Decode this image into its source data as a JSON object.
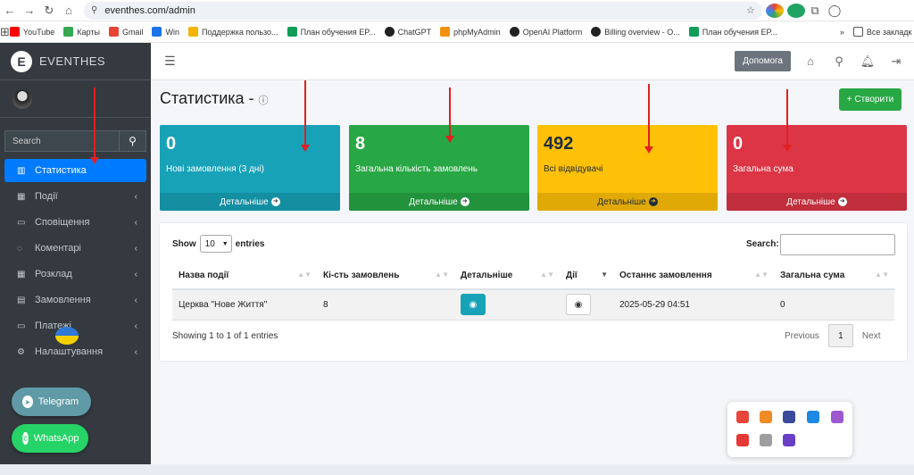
{
  "browser": {
    "url": "eventhes.com/admin",
    "bookmarks": [
      {
        "label": "YouTube",
        "color": "#ff0000"
      },
      {
        "label": "Карты",
        "color": "#34a853"
      },
      {
        "label": "Gmail",
        "color": "#ea4335"
      },
      {
        "label": "Win",
        "color": "#1a73e8"
      },
      {
        "label": "Поддержка пользо...",
        "color": "#f4b400"
      },
      {
        "label": "План обучения EP...",
        "color": "#0f9d58"
      },
      {
        "label": "ChatGPT",
        "color": "#222222"
      },
      {
        "label": "phpMyAdmin",
        "color": "#f29111"
      },
      {
        "label": "OpenAI Platform",
        "color": "#222222"
      },
      {
        "label": "Billing overview - O...",
        "color": "#222222"
      },
      {
        "label": "План обучения EP...",
        "color": "#0f9d58"
      }
    ],
    "bookmarks_more": "»",
    "all_bookmarks": "Все закладк"
  },
  "sidebar": {
    "brand_letter": "E",
    "brand_name": "EVENTHES",
    "search_placeholder": "Search",
    "menu": [
      {
        "label": "Статистика",
        "icon": "chart-icon",
        "glyph": "▥",
        "active": true
      },
      {
        "label": "Події",
        "icon": "calendar-icon",
        "glyph": "▦",
        "active": false
      },
      {
        "label": "Сповіщення",
        "icon": "message-icon",
        "glyph": "▭",
        "active": false
      },
      {
        "label": "Коментарі",
        "icon": "comment-icon",
        "glyph": "◌",
        "active": false
      },
      {
        "label": "Розклад",
        "icon": "schedule-icon",
        "glyph": "▦",
        "active": false
      },
      {
        "label": "Замовлення",
        "icon": "orders-icon",
        "glyph": "▤",
        "active": false
      },
      {
        "label": "Платежі",
        "icon": "payments-icon",
        "glyph": "▭",
        "active": false
      },
      {
        "label": "Налаштування",
        "icon": "settings-icon",
        "glyph": "⚙",
        "active": false
      }
    ],
    "telegram_label": "Telegram",
    "whatsapp_label": "WhatsApp"
  },
  "topbar": {
    "help_label": "Допомога"
  },
  "page": {
    "title": "Статистика -",
    "create_label": "+ Створити"
  },
  "cards": [
    {
      "value": "0",
      "label": "Нові замовлення (3 дні)",
      "more": "Детальніше",
      "color": "#17a2b8"
    },
    {
      "value": "8",
      "label": "Загальна кількість замовлень",
      "more": "Детальніше",
      "color": "#28a745"
    },
    {
      "value": "492",
      "label": "Всі відвідувачі",
      "more": "Детальніше",
      "color": "#ffc107"
    },
    {
      "value": "0",
      "label": "Загальна сума",
      "more": "Детальніше",
      "color": "#dc3545"
    }
  ],
  "table": {
    "show_label": "Show",
    "entries_value": "10",
    "entries_label": "entries",
    "search_label": "Search:",
    "columns": [
      "Назва події",
      "Кі-сть замовлень",
      "Детальніше",
      "Дії",
      "Останнє замовлення",
      "Загальна сума"
    ],
    "rows": [
      {
        "name": "Церква \"Нове Життя\"",
        "count": "8",
        "last_order": "2025-05-29 04:51",
        "total": "0"
      }
    ],
    "info": "Showing 1 to 1 of 1 entries",
    "prev_label": "Previous",
    "page": "1",
    "next_label": "Next"
  }
}
